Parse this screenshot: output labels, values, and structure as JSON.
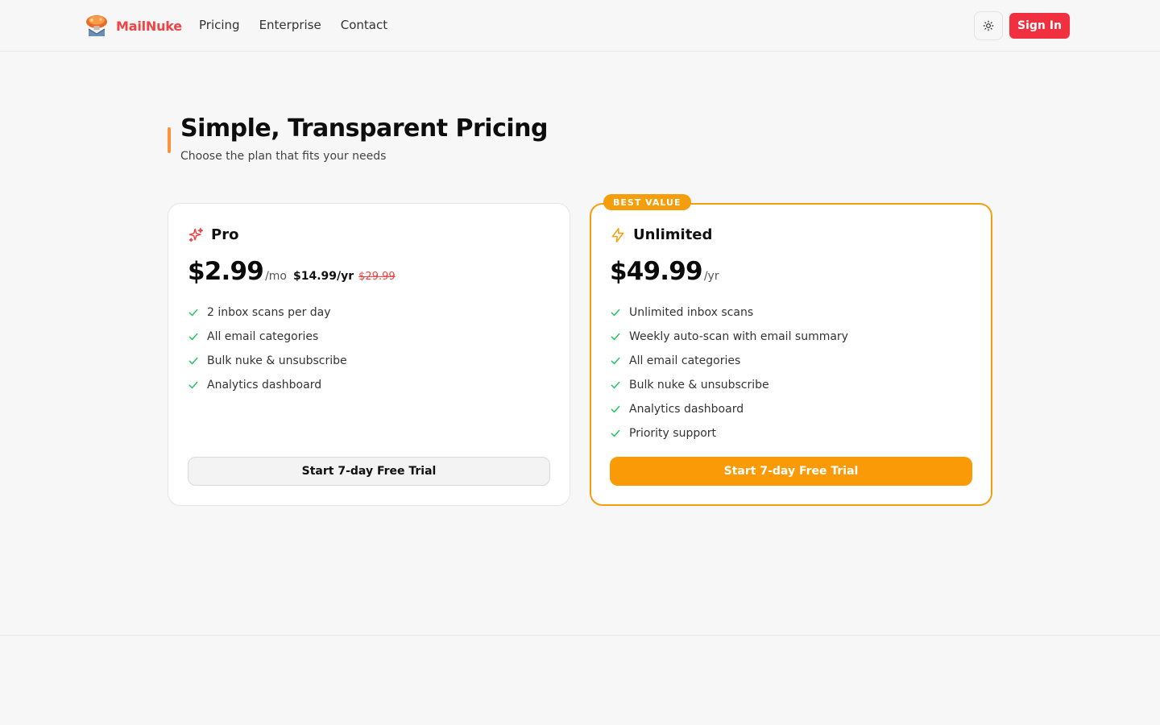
{
  "brand": {
    "name": "MailNuke"
  },
  "nav": {
    "items": [
      "Pricing",
      "Enterprise",
      "Contact"
    ]
  },
  "header": {
    "sign_in": "Sign In"
  },
  "page": {
    "title": "Simple, Transparent Pricing",
    "subtitle": "Choose the plan that fits your needs"
  },
  "plans": {
    "pro": {
      "name": "Pro",
      "icon": "sparkles-icon",
      "price": "$2.99",
      "period": "/mo",
      "yearly_price": "$14.99/yr",
      "old_price": "$29.99",
      "features": [
        "2 inbox scans per day",
        "All email categories",
        "Bulk nuke & unsubscribe",
        "Analytics dashboard"
      ],
      "cta": "Start 7-day Free Trial"
    },
    "unlimited": {
      "badge": "BEST VALUE",
      "name": "Unlimited",
      "icon": "lightning-bolt-icon",
      "price": "$49.99",
      "period": "/yr",
      "features": [
        "Unlimited inbox scans",
        "Weekly auto-scan with email summary",
        "All email categories",
        "Bulk nuke & unsubscribe",
        "Analytics dashboard",
        "Priority support"
      ],
      "cta": "Start 7-day Free Trial"
    }
  },
  "colors": {
    "accent": "#f59e0b",
    "brand_red": "#ef4444",
    "sign_in_bg": "#f0303e",
    "check_green": "#22c55e",
    "title_bar": "#fb923c"
  }
}
